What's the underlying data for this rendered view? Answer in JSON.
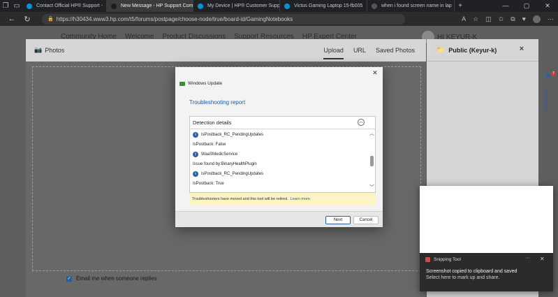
{
  "browser": {
    "tabs": [
      {
        "label": "Contact Official HP® Support - ",
        "active": false,
        "favicon_color": "#0096d6"
      },
      {
        "label": "New Message - HP Support Com",
        "active": true,
        "favicon_color": "#1c1c1c"
      },
      {
        "label": "My Device | HP® Customer Supp",
        "active": false,
        "favicon_color": "#0096d6"
      },
      {
        "label": "Victus Gaming Laptop 15-fb005",
        "active": false,
        "favicon_color": "#0096d6"
      },
      {
        "label": "when i found screen name in lap",
        "active": false,
        "favicon_color": "#555555"
      }
    ],
    "new_tab": "+",
    "url": "https://h30434.www3.hp.com/t5/forums/postpage/choose-node/true/board-id/GamingNotebooks"
  },
  "site": {
    "nav": [
      "Community Home",
      "Welcome",
      "Product Discussions",
      "Support Resources",
      "HP Expert Center"
    ],
    "user": "HI KEYUR-K"
  },
  "photos_modal": {
    "title": "Photos",
    "tabs": [
      "Upload",
      "URL",
      "Saved Photos"
    ],
    "email_label": "Email me when someone replies"
  },
  "right_panel": {
    "title": "Public (Keyur-k)",
    "close": "×"
  },
  "feedback": {
    "label": "Feedback",
    "badge": "7"
  },
  "dialog": {
    "app_name": "Windows Update",
    "heading": "Troubleshooting report",
    "details_title": "Detection details",
    "entries": [
      {
        "text": "IsPostback_RC_PendingUpdates",
        "icon": true
      },
      {
        "text": "IsPostback: False",
        "icon": false
      },
      {
        "text": "WaaSMedicService",
        "icon": true
      },
      {
        "text": "Issue found by:BinaryHealthPlugin",
        "icon": false
      },
      {
        "text": "IsPostback_RC_PendingUpdates",
        "icon": true
      },
      {
        "text": "IsPostback: True",
        "icon": false
      }
    ],
    "notice_text": "Troubleshooters have moved and this tool will be retired.",
    "notice_link": "Learn more.",
    "next_label": "Next",
    "cancel_label": "Cancel"
  },
  "toast": {
    "app": "Snipping Tool",
    "more": "···",
    "close": "✕",
    "message": "Screenshot copied to clipboard and saved",
    "sub": "Select here to mark up and share."
  },
  "colors": {
    "dialog_heading": "#1f5aa6",
    "info_icon": "#2d5ea8",
    "notice_bg": "#fcf4c4",
    "toast_bg": "#2b2b2b"
  }
}
